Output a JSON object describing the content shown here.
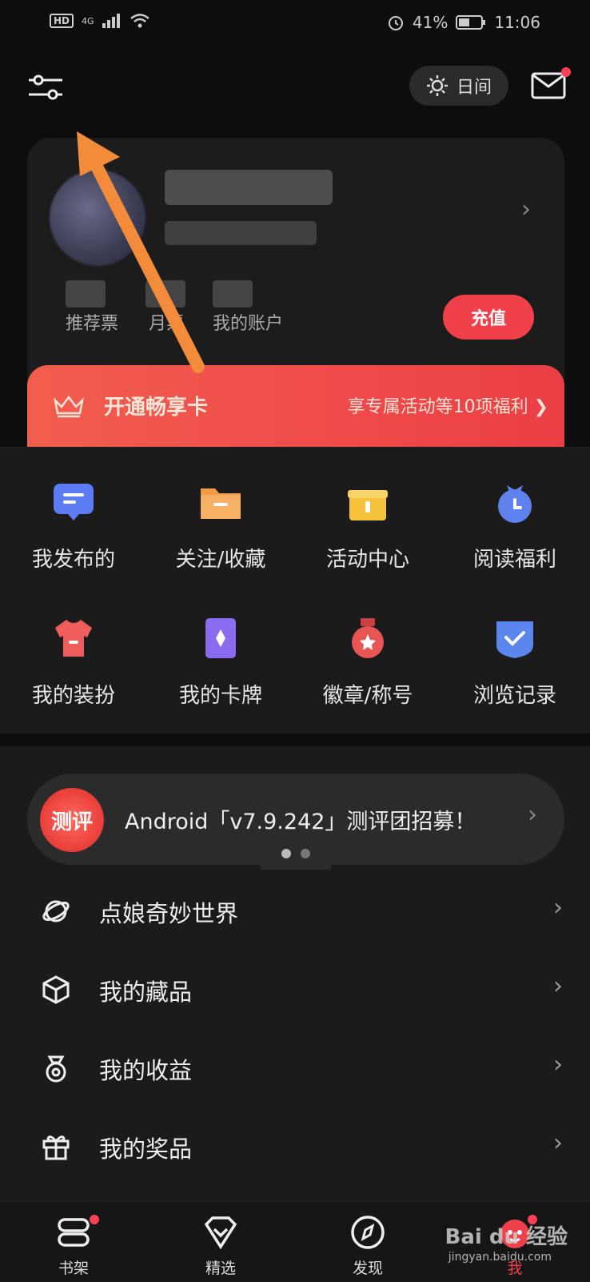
{
  "status_bar": {
    "network": "4G",
    "hd": "HD",
    "battery": "41%",
    "time": "11:06"
  },
  "header": {
    "day_mode_label": "日间"
  },
  "profile": {
    "stats": [
      {
        "label": "推荐票"
      },
      {
        "label": "月票"
      },
      {
        "label": "我的账户"
      }
    ],
    "recharge_label": "充值",
    "vip": {
      "title": "开通畅享卡",
      "desc": "享专属活动等10项福利 ❯"
    }
  },
  "grid": [
    {
      "label": "我发布的",
      "icon": "message-icon",
      "color": "#5b7cf5"
    },
    {
      "label": "关注/收藏",
      "icon": "folder-icon",
      "color": "#f39a45"
    },
    {
      "label": "活动中心",
      "icon": "gift-icon",
      "color": "#f5c23a"
    },
    {
      "label": "阅读福利",
      "icon": "clock-bag-icon",
      "color": "#5f82ee"
    },
    {
      "label": "我的装扮",
      "icon": "shirt-icon",
      "color": "#ef5d5d"
    },
    {
      "label": "我的卡牌",
      "icon": "card-icon",
      "color": "#8a6cf0"
    },
    {
      "label": "徽章/称号",
      "icon": "medal-icon",
      "color": "#e95454"
    },
    {
      "label": "浏览记录",
      "icon": "shield-check-icon",
      "color": "#5b86ee"
    }
  ],
  "banner": {
    "icon_text": "测评",
    "text": "Android「v7.9.242」测评团招募！"
  },
  "list": [
    {
      "label": "点娘奇妙世界",
      "icon": "orbit-icon"
    },
    {
      "label": "我的藏品",
      "icon": "cube-icon"
    },
    {
      "label": "我的收益",
      "icon": "moneybag-icon"
    },
    {
      "label": "我的奖品",
      "icon": "giftbox-icon"
    }
  ],
  "bottom_nav": [
    {
      "label": "书架",
      "icon": "bookshelf-icon"
    },
    {
      "label": "精选",
      "icon": "diamond-icon"
    },
    {
      "label": "发现",
      "icon": "compass-icon"
    },
    {
      "label": "我",
      "icon": "profile-icon"
    }
  ],
  "watermark": {
    "brand": "Bai du 经验",
    "url": "jingyan.baidu.com"
  },
  "colors": {
    "accent": "#f0404a",
    "annotation_arrow": "#f28b3a"
  }
}
